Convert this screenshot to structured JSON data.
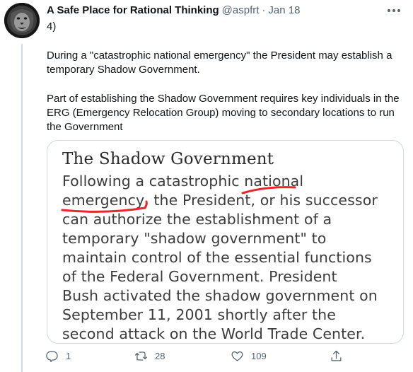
{
  "tweet": {
    "display_name": "A Safe Place for Rational Thinking",
    "handle": "@aspfrt",
    "separator": "·",
    "date": "Jan 18",
    "text_1": "4)",
    "text_2": "During a \"catastrophic national emergency\" the President may establish a temporary Shadow Government.",
    "text_3": "Part of establishing the Shadow Government requires key individuals in the ERG (Emergency Relocation Group) moving to secondary locations to run the Government"
  },
  "media": {
    "title": "The Shadow Government",
    "lines": [
      "Following a catastrophic national",
      "emergency, the President, or his successor",
      "can authorize the establishment of a",
      "temporary \"shadow government\" to",
      "maintain control of the essential functions",
      "of the Federal Government. President",
      "Bush activated the shadow government on",
      "September 11, 2001 shortly after the",
      "second attack on the World Trade Center."
    ],
    "highlight_color": "#e8262b"
  },
  "actions": {
    "replies": "1",
    "retweets": "28",
    "likes": "109"
  },
  "icons": {
    "reply": "reply-icon",
    "retweet": "retweet-icon",
    "like": "heart-icon",
    "share": "share-icon",
    "more": "more-icon"
  }
}
